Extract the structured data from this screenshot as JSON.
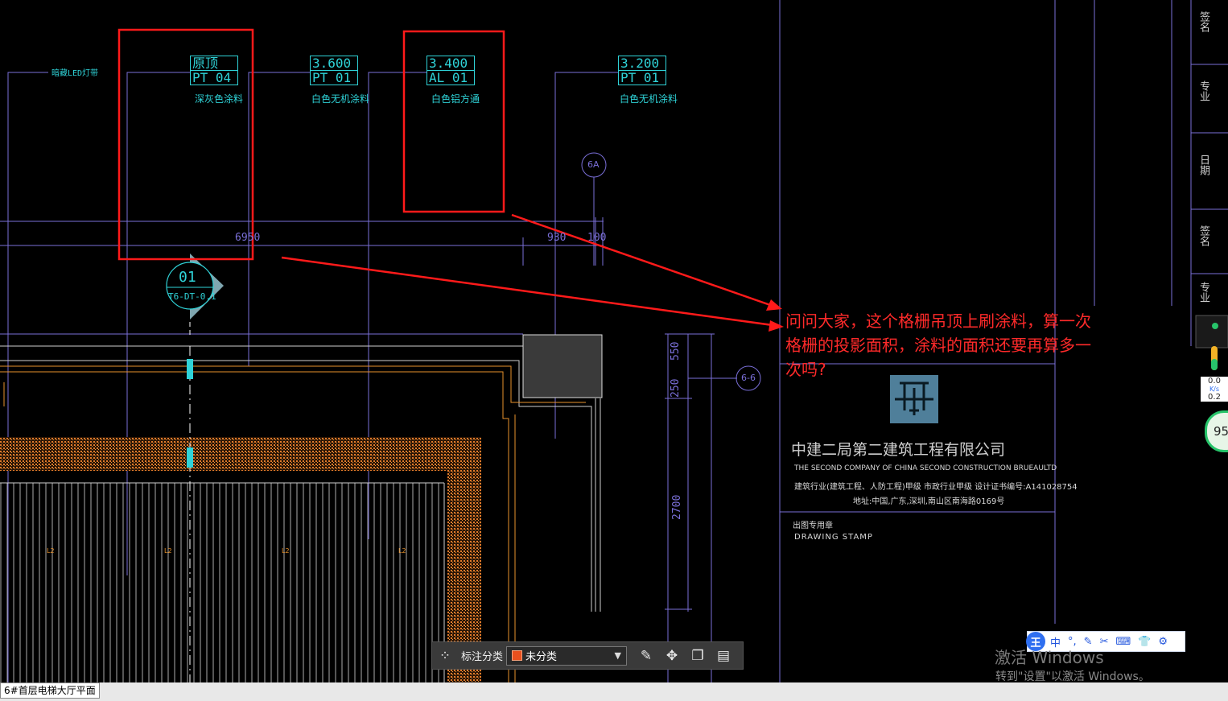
{
  "app": {
    "status_tab": "6#首层电梯大厅平面"
  },
  "drawing": {
    "led_label": "暗藏LED灯带",
    "tags": [
      {
        "top": "原顶",
        "code": "PT 04",
        "desc": "深灰色涂料"
      },
      {
        "top": "3.600",
        "code": "PT 01",
        "desc": "白色无机涂料"
      },
      {
        "top": "3.400",
        "code": "AL 01",
        "desc": "白色铝方通"
      },
      {
        "top": "3.200",
        "code": "PT 01",
        "desc": "白色无机涂料"
      }
    ],
    "section_mark": {
      "num": "01",
      "ref": "T6-DT-0.1"
    },
    "bubbles": [
      "6A",
      "6-6"
    ],
    "dims": [
      "6950",
      "930",
      "100",
      "550",
      "250",
      "2700"
    ],
    "hatch_tags": [
      "L2",
      "L2",
      "L2",
      "L2"
    ]
  },
  "annotation": {
    "text": "问问大家，这个格栅吊顶上刷涂料，算一次格栅的投影面积，涂料的面积还要再算多一次吗?",
    "color": "#ff2a2a"
  },
  "title_block": {
    "company_cn": "中建二局第二建筑工程有限公司",
    "company_en": "THE SECOND COMPANY OF CHINA SECOND CONSTRUCTION BRUEAULTD",
    "qualification": "建筑行业(建筑工程、人防工程)甲级  市政行业甲级  设计证书编号:A141028754",
    "address": "地址:中国,广东,深圳,南山区南海路0169号",
    "stamp_cn": "出图专用章",
    "stamp_en": "DRAWING STAMP",
    "side_labels": [
      "签名",
      "专业",
      "日期",
      "签名",
      "专业"
    ]
  },
  "toolbar": {
    "label": "标注分类",
    "select_value": "未分类",
    "swatch_color": "#e8501e"
  },
  "ime": {
    "logo": "王",
    "items": [
      "中",
      "°,",
      "✎",
      "✂",
      "⌨",
      "👕",
      "⚙"
    ]
  },
  "system": {
    "watermark_title": "激活 Windows",
    "watermark_sub": "转到\"设置\"以激活 Windows。",
    "speed_value": "0.0",
    "speed_unit": "K/s",
    "speed_value2": "0.2",
    "gauge_value": "95"
  }
}
